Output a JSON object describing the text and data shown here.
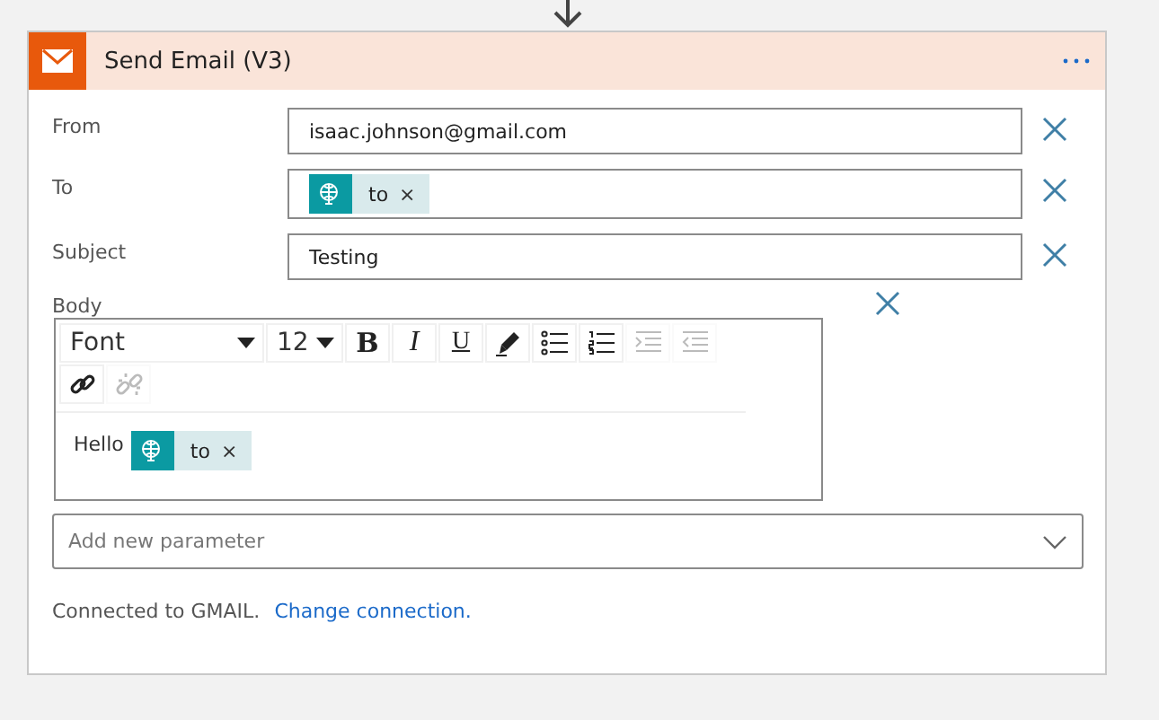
{
  "header": {
    "title": "Send Email (V3)"
  },
  "fields": [
    {
      "label": "From",
      "kind": "text",
      "value": "isaac.johnson@gmail.com"
    },
    {
      "label": "To",
      "kind": "tokens",
      "tokens": [
        {
          "label": "to",
          "remove": "×"
        }
      ]
    },
    {
      "label": "Subject",
      "kind": "text",
      "value": "Testing"
    }
  ],
  "body": {
    "label": "Body",
    "toolbar": [
      {
        "kind": "font",
        "label": "Font",
        "disabled": false
      },
      {
        "kind": "size",
        "label": "12",
        "disabled": false
      },
      {
        "kind": "bold",
        "label": "B",
        "disabled": false
      },
      {
        "kind": "italic",
        "label": "I",
        "disabled": false
      },
      {
        "kind": "underline",
        "label": "U",
        "disabled": false
      },
      {
        "kind": "color",
        "disabled": false
      },
      {
        "kind": "bullets",
        "disabled": false
      },
      {
        "kind": "numbers",
        "disabled": false
      },
      {
        "kind": "indent",
        "disabled": true
      },
      {
        "kind": "outdent",
        "disabled": true
      },
      {
        "kind": "link",
        "disabled": false
      },
      {
        "kind": "unlink",
        "disabled": true
      }
    ],
    "text": "Hello",
    "tokens": [
      {
        "label": "to",
        "remove": "×"
      }
    ]
  },
  "add_parameter": {
    "placeholder": "Add new parameter"
  },
  "footer": {
    "text": "Connected to GMAIL.",
    "link": "Change connection."
  }
}
